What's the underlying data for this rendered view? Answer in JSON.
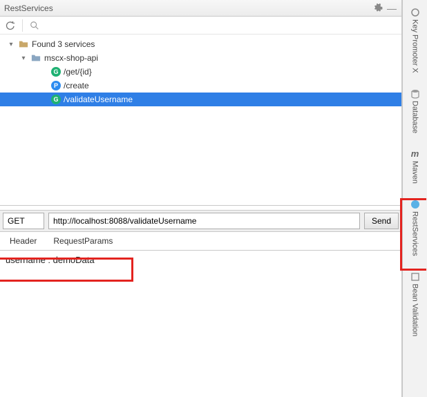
{
  "title": "RestServices",
  "tree": {
    "root": "Found 3 services",
    "module": "mscx-shop-api",
    "endpoints": [
      {
        "method": "G",
        "path": "/get/{id}"
      },
      {
        "method": "P",
        "path": "/create"
      },
      {
        "method": "G",
        "path": "/validateUsername"
      }
    ]
  },
  "request": {
    "method": "GET",
    "url": "http://localhost:8088/validateUsername",
    "send": "Send"
  },
  "tabs": {
    "header": "Header",
    "params": "RequestParams"
  },
  "params": {
    "line": "username : demoData"
  },
  "sidebar": {
    "items": [
      {
        "label": "Key Promoter X"
      },
      {
        "label": "Database"
      },
      {
        "label": "Maven"
      },
      {
        "label": "RestServices"
      },
      {
        "label": "Bean Validation"
      }
    ]
  }
}
